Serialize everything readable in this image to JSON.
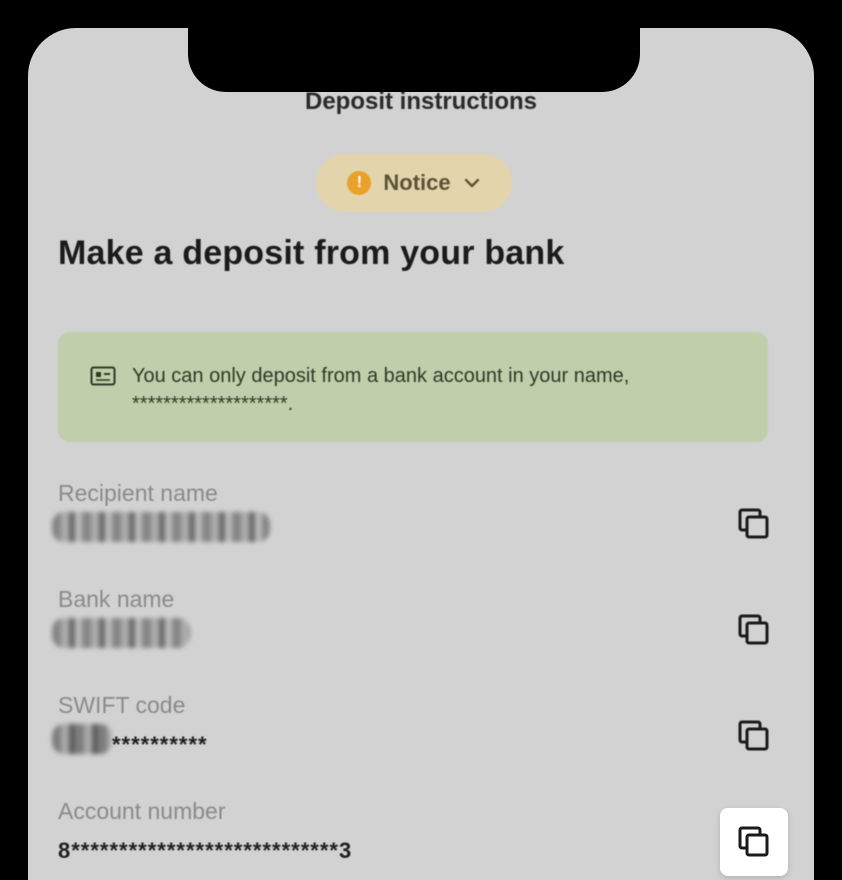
{
  "header": {
    "title": "Deposit instructions"
  },
  "notice": {
    "label": "Notice",
    "icon": "warning-icon",
    "color": "#e9a12a"
  },
  "page": {
    "heading": "Make a deposit from your bank"
  },
  "info_box": {
    "icon": "id-card-icon",
    "line1": "You can only deposit from a bank account in your name,",
    "line2": "********************."
  },
  "fields": {
    "recipient": {
      "label": "Recipient name",
      "value": ""
    },
    "bank": {
      "label": "Bank name",
      "value": ""
    },
    "swift": {
      "label": "SWIFT code",
      "value_masked": "**********"
    },
    "account": {
      "label": "Account number",
      "value": "8****************************3"
    }
  },
  "colors": {
    "screen_bg": "#d2d2d2",
    "notice_bg": "#e4d4ac",
    "info_bg": "#c0ceac"
  }
}
